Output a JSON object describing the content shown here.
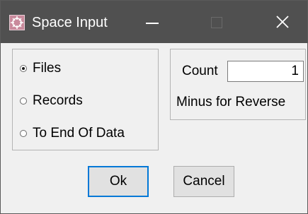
{
  "window": {
    "title": "Space Input",
    "app_icon": "app-emblem-icon",
    "controls": {
      "minimize": "minimize-icon",
      "maximize": "maximize-icon",
      "close": "close-icon"
    }
  },
  "mode_group": {
    "options": [
      {
        "label": "Files",
        "selected": true
      },
      {
        "label": "Records",
        "selected": false
      },
      {
        "label": "To End Of Data",
        "selected": false
      }
    ]
  },
  "count_group": {
    "count_label": "Count",
    "count_value": "1",
    "hint": "Minus for Reverse"
  },
  "buttons": {
    "ok": "Ok",
    "cancel": "Cancel"
  },
  "colors": {
    "titlebar": "#505050",
    "focus_border": "#0078d7"
  }
}
